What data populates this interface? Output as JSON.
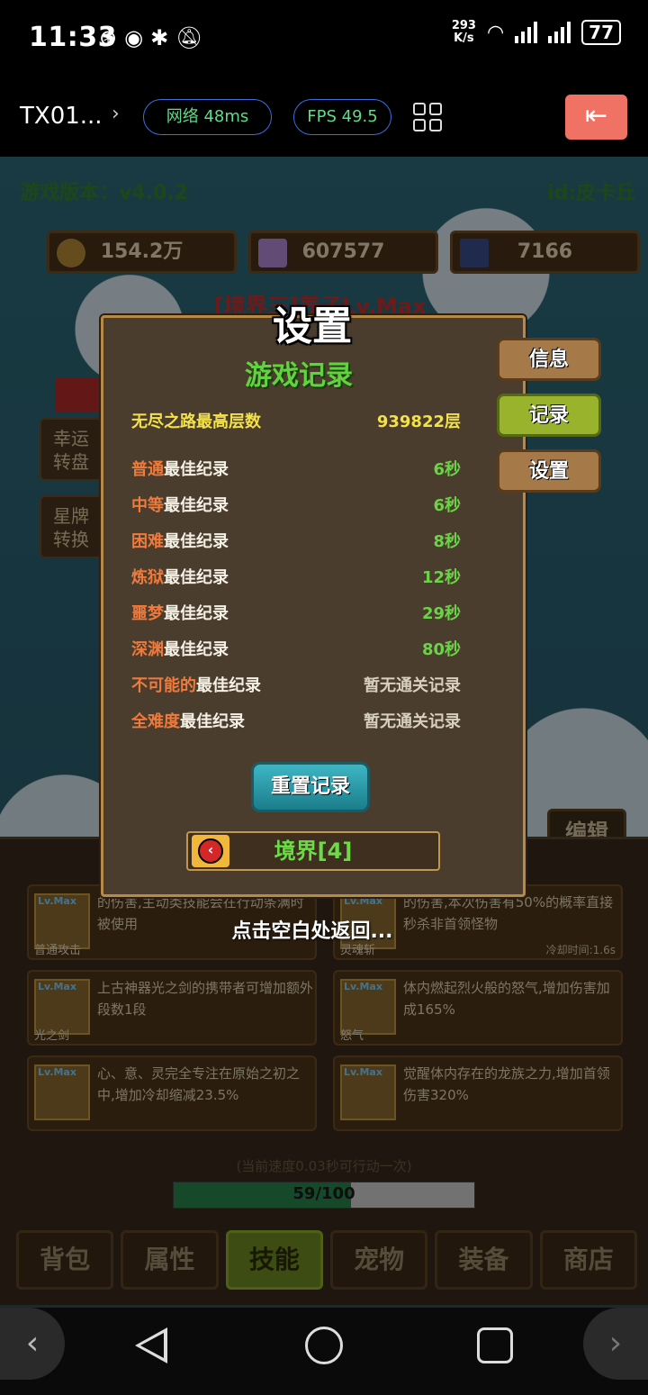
{
  "status_bar": {
    "time": "11:33",
    "net_speed_value": "293",
    "net_speed_unit": "K/s",
    "battery": "77"
  },
  "title_bar": {
    "name": "TX01...",
    "network": "网络 48ms",
    "fps": "FPS 49.5"
  },
  "game": {
    "version": "游戏版本：v4.0.2",
    "user_id": "id:皮卡丘",
    "resources": [
      "154.2万",
      "607577",
      "7166"
    ],
    "realm_title": "[境界三]养子Lv.Max",
    "side_buttons": [
      "幸运\n转盘",
      "星牌\n转换"
    ],
    "edit": "编辑",
    "skills": [
      {
        "name": "普通攻击",
        "badge": "Lv.Max",
        "desc": "的伤害,主动类技能会在行动条满时被使用"
      },
      {
        "name": "灵魂斩",
        "badge": "Lv.Max",
        "desc": "的伤害,本次伤害有50%的概率直接秒杀非首领怪物"
      },
      {
        "name": "光之剑",
        "badge": "Lv.Max",
        "desc": "上古神器光之剑的携带者可增加额外段数1段"
      },
      {
        "name": "怒气",
        "badge": "Lv.Max",
        "desc": "体内燃起烈火般的怒气,增加伤害加成165%"
      },
      {
        "name": "",
        "badge": "Lv.Max",
        "desc": "心、意、灵完全专注在原始之初之中,增加冷却缩减23.5%"
      },
      {
        "name": "",
        "badge": "Lv.Max",
        "desc": "觉醒体内存在的龙族之力,增加首领伤害320%"
      }
    ],
    "cooldown": "冷却时间:1.6s",
    "speed_note": "(当前速度0.03秒可行动一次)",
    "progress": {
      "text": "59/100",
      "fraction": 0.59
    },
    "tabs": [
      "背包",
      "属性",
      "技能",
      "宠物",
      "装备",
      "商店"
    ],
    "active_tab": "技能"
  },
  "dialog": {
    "title": "设置",
    "subtitle": "游戏记录",
    "endless": {
      "label": "无尽之路最高层数",
      "value": "939822层"
    },
    "records": [
      {
        "difficulty": "普通",
        "suffix": "最佳纪录",
        "value": "6秒"
      },
      {
        "difficulty": "中等",
        "suffix": "最佳纪录",
        "value": "6秒"
      },
      {
        "difficulty": "困难",
        "suffix": "最佳纪录",
        "value": "8秒"
      },
      {
        "difficulty": "炼狱",
        "suffix": "最佳纪录",
        "value": "12秒"
      },
      {
        "difficulty": "噩梦",
        "suffix": "最佳纪录",
        "value": "29秒"
      },
      {
        "difficulty": "深渊",
        "suffix": "最佳纪录",
        "value": "80秒"
      },
      {
        "difficulty": "不可能的",
        "suffix": "最佳纪录",
        "value": "暂无通关记录"
      },
      {
        "difficulty": "全难度",
        "suffix": "最佳纪录",
        "value": "暂无通关记录"
      }
    ],
    "reset_button": "重置记录",
    "realm_button": "境界[4]",
    "tabs": {
      "info": "信息",
      "record": "记录",
      "settings": "设置"
    },
    "tap_hint": "点击空白处返回..."
  }
}
